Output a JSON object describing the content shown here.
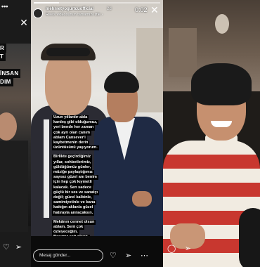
{
  "left": {
    "dots": "•••",
    "banners": [
      "R",
      "T",
      "İNSAN",
      "DIM"
    ],
    "close": "✕",
    "icons": [
      "heart-icon",
      "send-icon"
    ]
  },
  "story": {
    "username": "mehmetyogurtcuofficial",
    "time": "2d",
    "subtitle": "Reels videosunun tamamını izle",
    "clock": "0:02",
    "progress": 0.2,
    "caption": [
      [
        "Uzun yıllardır abla",
        "kardeş gibi olduğumuz,",
        "yeri bende her zaman",
        "çok ayrı olan canım",
        "ablam Cansever'i",
        "kaybetmenin derin",
        "üzüntüsünü yaşıyorum."
      ],
      [
        "Birlikte geçirdiğimiz",
        "yıllar, sohbetlerimiz,",
        "güldüğümüz günler,",
        "müziğe paylaştığımız",
        "sayısız güzel anı benim",
        "için hep çok kıymetli",
        "kalacak. Sen sadece",
        "güçlü bir ses ve sanatçı",
        "değil; güzel kalbinle,",
        "samimiyetinle ve bana",
        "kattığın aklanla güzel",
        "hatırayla anılacaksın."
      ],
      [
        "Mekânın cennet olsun",
        "ablam. Seni çok",
        "özleyeceğim.",
        "Başımız sağ olsun."
      ]
    ],
    "reply_placeholder": "Mesaj gönder...",
    "icons": [
      "heart-icon",
      "send-icon",
      "ellipsis-icon"
    ]
  },
  "right": {
    "icons": [
      "comment-icon",
      "send-icon"
    ]
  },
  "colors": {
    "caption_bg": "#000000",
    "caption_text": "#ffffff"
  }
}
